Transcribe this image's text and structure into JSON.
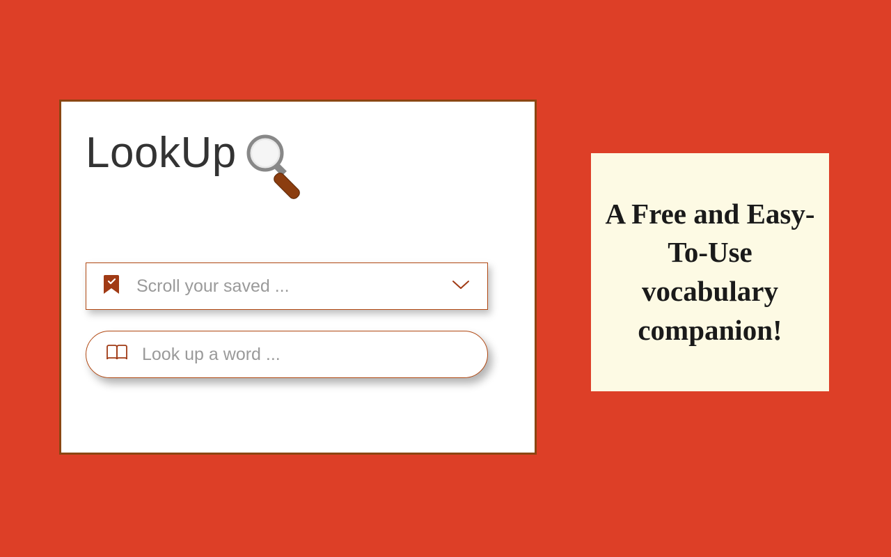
{
  "logo": {
    "title": "LookUp"
  },
  "dropdown": {
    "placeholder": "Scroll your saved ..."
  },
  "search": {
    "placeholder": "Look up a word ..."
  },
  "promo": {
    "text": "A Free and Easy-To-Use vocabulary companion!"
  },
  "colors": {
    "background": "#dd3f27",
    "accent": "#b14812",
    "promo_bg": "#fdfae4"
  }
}
